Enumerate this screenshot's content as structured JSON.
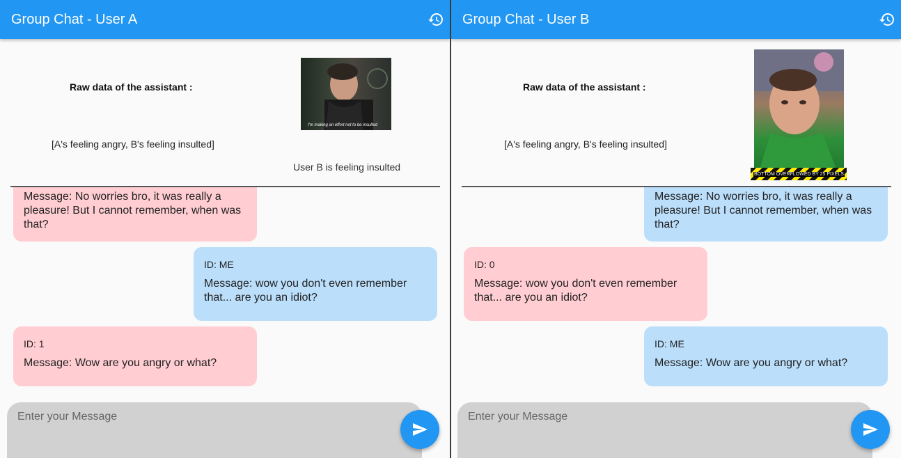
{
  "colors": {
    "appbar": "#2196f3",
    "pink_bubble": "#ffcdd2",
    "blue_bubble": "#bbdefb",
    "input_bg": "#d1d1d1"
  },
  "left": {
    "title": "Group Chat - User A",
    "history_icon": "history-icon",
    "raw_label": "Raw data of the assistant :",
    "raw_data": "[A's feeling angry, B's feeling insulted]",
    "image_caption": "I'm making an effort not to be insulted",
    "assistant_caption": "User B is feeling insulted",
    "messages": [
      {
        "id": "",
        "text": "Message: No worries bro, it was really a pleasure! But I cannot remember, when was that?"
      },
      {
        "id": "ID: ME",
        "text": "Message: wow you don't even remember that... are you an idiot?"
      },
      {
        "id": "ID: 1",
        "text": "Message: Wow are you angry or what?"
      }
    ],
    "input_placeholder": "Enter your Message",
    "send_icon": "send-icon"
  },
  "right": {
    "title": "Group Chat - User B",
    "history_icon": "history-icon",
    "raw_label": "Raw data of the assistant :",
    "raw_data": "[A's feeling angry, B's feeling insulted]",
    "overflow_text": "BOTTOM OVERFLOWED BY 25 PIXELS",
    "messages": [
      {
        "id": "",
        "text": "Message: No worries bro, it was really a pleasure! But I cannot remember, when was that?"
      },
      {
        "id": "ID: 0",
        "text": "Message: wow you don't even remember that... are you an idiot?"
      },
      {
        "id": "ID: ME",
        "text": "Message: Wow are you angry or what?"
      }
    ],
    "input_placeholder": "Enter your Message",
    "send_icon": "send-icon"
  }
}
